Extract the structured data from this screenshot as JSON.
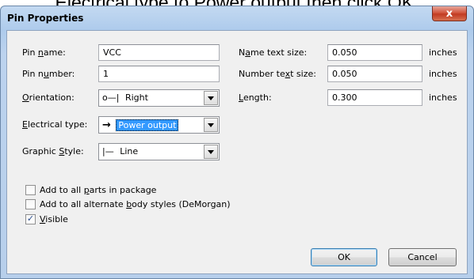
{
  "caption": "Electrical type to Power output then click OK.",
  "window": {
    "title": "Pin Properties",
    "close_glyph": "x"
  },
  "fields": {
    "pin_name": {
      "label_pre": "Pin ",
      "label_ul": "n",
      "label_post": "ame:",
      "value": "VCC"
    },
    "pin_number": {
      "label_pre": "Pin n",
      "label_ul": "u",
      "label_post": "mber:",
      "value": "1"
    },
    "orientation": {
      "label_pre": "",
      "label_ul": "O",
      "label_post": "rientation:",
      "value": "Right",
      "glyph": "o—|"
    },
    "electrical_type": {
      "label_pre": "",
      "label_ul": "E",
      "label_post": "lectrical type:",
      "value": "Power output",
      "glyph": "→"
    },
    "graphic_style": {
      "label_pre": "Graphic ",
      "label_ul": "S",
      "label_post": "tyle:",
      "value": "Line",
      "glyph": "|—"
    },
    "name_text_size": {
      "label_pre": "N",
      "label_ul": "a",
      "label_post": "me text size:",
      "value": "0.050",
      "unit": "inches"
    },
    "number_text_size": {
      "label_pre": "Number te",
      "label_ul": "x",
      "label_post": "t size:",
      "value": "0.050",
      "unit": "inches"
    },
    "length": {
      "label_pre": "",
      "label_ul": "L",
      "label_post": "ength:",
      "value": "0.300",
      "unit": "inches"
    }
  },
  "checkboxes": {
    "add_all_parts": {
      "label_pre": "Add to all ",
      "label_ul": "p",
      "label_post": "arts in package",
      "checked": false
    },
    "add_all_body_styles": {
      "label_pre": "Add to all alternate ",
      "label_ul": "b",
      "label_post": "ody styles (DeMorgan)",
      "checked": false
    },
    "visible": {
      "label_pre": "",
      "label_ul": "V",
      "label_post": "isible",
      "checked": true,
      "check_glyph": "✓"
    }
  },
  "buttons": {
    "ok": "OK",
    "cancel": "Cancel"
  },
  "colors": {
    "selection": "#3399ff",
    "close": "#c23b22"
  }
}
